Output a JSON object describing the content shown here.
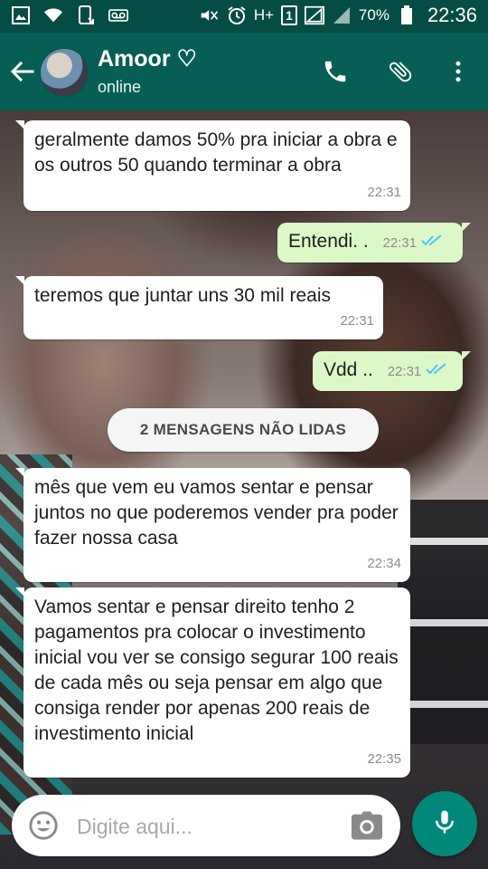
{
  "status_bar": {
    "battery_percent": "70%",
    "time": "22:36",
    "network_type": "H+",
    "sim_slot": "1",
    "icons": [
      "image-icon",
      "wifi-icon",
      "phone-download-icon",
      "voicemail-icon",
      "mute-icon",
      "alarm-icon",
      "signal-icon",
      "battery-icon"
    ]
  },
  "header": {
    "contact_name": "Amoor ♡",
    "contact_status": "online",
    "icons": [
      "back-arrow-icon",
      "call-icon",
      "attachment-icon",
      "more-vert-icon"
    ]
  },
  "messages": [
    {
      "direction": "in",
      "text": "geralmente damos 50% pra iniciar a obra e os outros 50 quando terminar a obra",
      "time": "22:31"
    },
    {
      "direction": "out",
      "text": "Entendi. .",
      "time": "22:31",
      "ticks": "double-check"
    },
    {
      "direction": "in",
      "text": "teremos que juntar uns 30 mil reais",
      "time": "22:31"
    },
    {
      "direction": "out",
      "text": "Vdd ..",
      "time": "22:31",
      "ticks": "double-check"
    },
    {
      "direction": "in",
      "text": "mês que vem eu vamos sentar e pensar juntos no que poderemos vender pra poder fazer nossa casa",
      "time": "22:34"
    },
    {
      "direction": "in",
      "text": "Vamos sentar e pensar direito tenho 2 pagamentos pra colocar o investimento inicial vou ver se consigo segurar 100 reais de cada mês ou seja pensar em algo que consiga render por apenas 200 reais de investimento inicial",
      "time": "22:35"
    }
  ],
  "unread_banner": "2 MENSAGENS NÃO LIDAS",
  "composer": {
    "placeholder": "Digite aqui...",
    "icons": [
      "emoji-icon",
      "camera-icon",
      "mic-icon"
    ]
  },
  "colors": {
    "header": "#075e54",
    "status_bar": "#054d44",
    "outgoing_bubble": "#dcf8c6",
    "incoming_bubble": "#ffffff",
    "read_ticks": "#4fc3f7",
    "mic_button": "#00897b"
  }
}
